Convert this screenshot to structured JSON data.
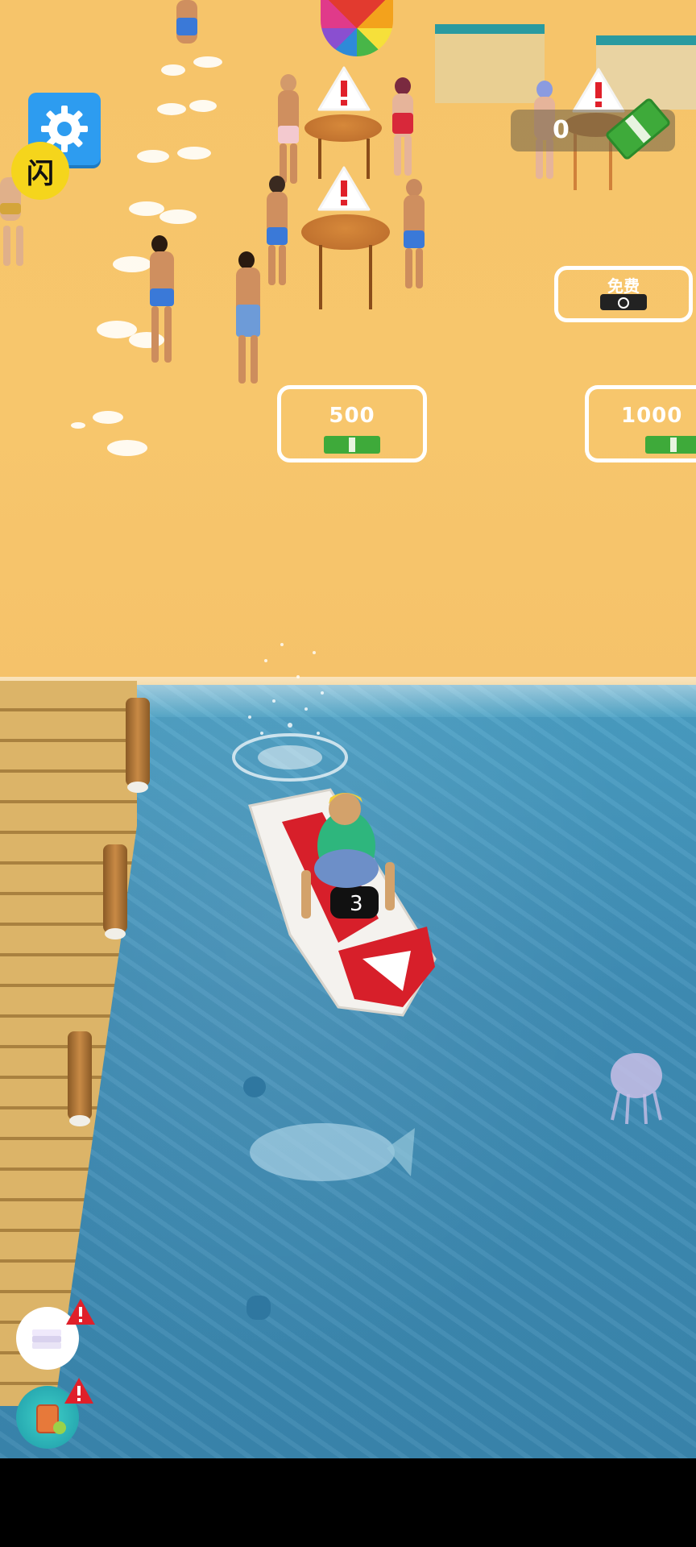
{
  "hud": {
    "settings_icon": "gear-icon",
    "flash_icon_text": "闪",
    "money_counter": "0",
    "money_icon": "cash-icon"
  },
  "pads": [
    {
      "price": "500",
      "icon": "cash-icon"
    },
    {
      "price": "1000",
      "icon": "cash-icon"
    },
    {
      "label": "免费",
      "icon": "video-icon"
    }
  ],
  "side_buttons": [
    {
      "icon": "towel-stack-icon",
      "badge": "!"
    },
    {
      "icon": "drink-icon",
      "badge": "!"
    }
  ],
  "colors": {
    "sand": "#f6c46a",
    "water": "#3f8db6",
    "settings_blue": "#2d9cf0",
    "flash_yellow": "#f5d51c",
    "alert_red": "#e0202a",
    "cash_green": "#3eaa3a"
  }
}
